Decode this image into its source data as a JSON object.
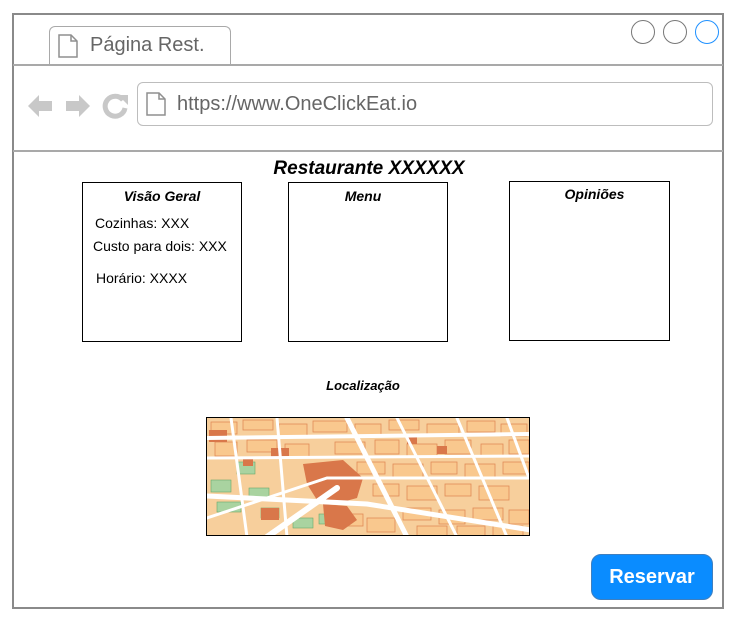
{
  "browser": {
    "tab_title": "Página Rest.",
    "url": "https://www.OneClickEat.io",
    "icons": {
      "tab": "document-icon",
      "back": "back-arrow-icon",
      "forward": "forward-arrow-icon",
      "reload": "reload-icon",
      "url": "document-icon"
    },
    "window_controls": [
      "minimize-circle",
      "maximize-circle",
      "close-circle"
    ],
    "accent_color": "#1e90ff"
  },
  "page": {
    "title": "Restaurante XXXXXX",
    "overview": {
      "title": "Visão Geral",
      "cuisines": "Cozinhas: XXX",
      "cost_for_two": "Custo para dois: XXX",
      "hours": "Horário: XXXX"
    },
    "menu": {
      "title": "Menu"
    },
    "reviews": {
      "title": "Opiniões"
    },
    "location": {
      "title": "Localização"
    },
    "reserve_button": "Reservar",
    "reserve_color": "#0a8cff"
  }
}
